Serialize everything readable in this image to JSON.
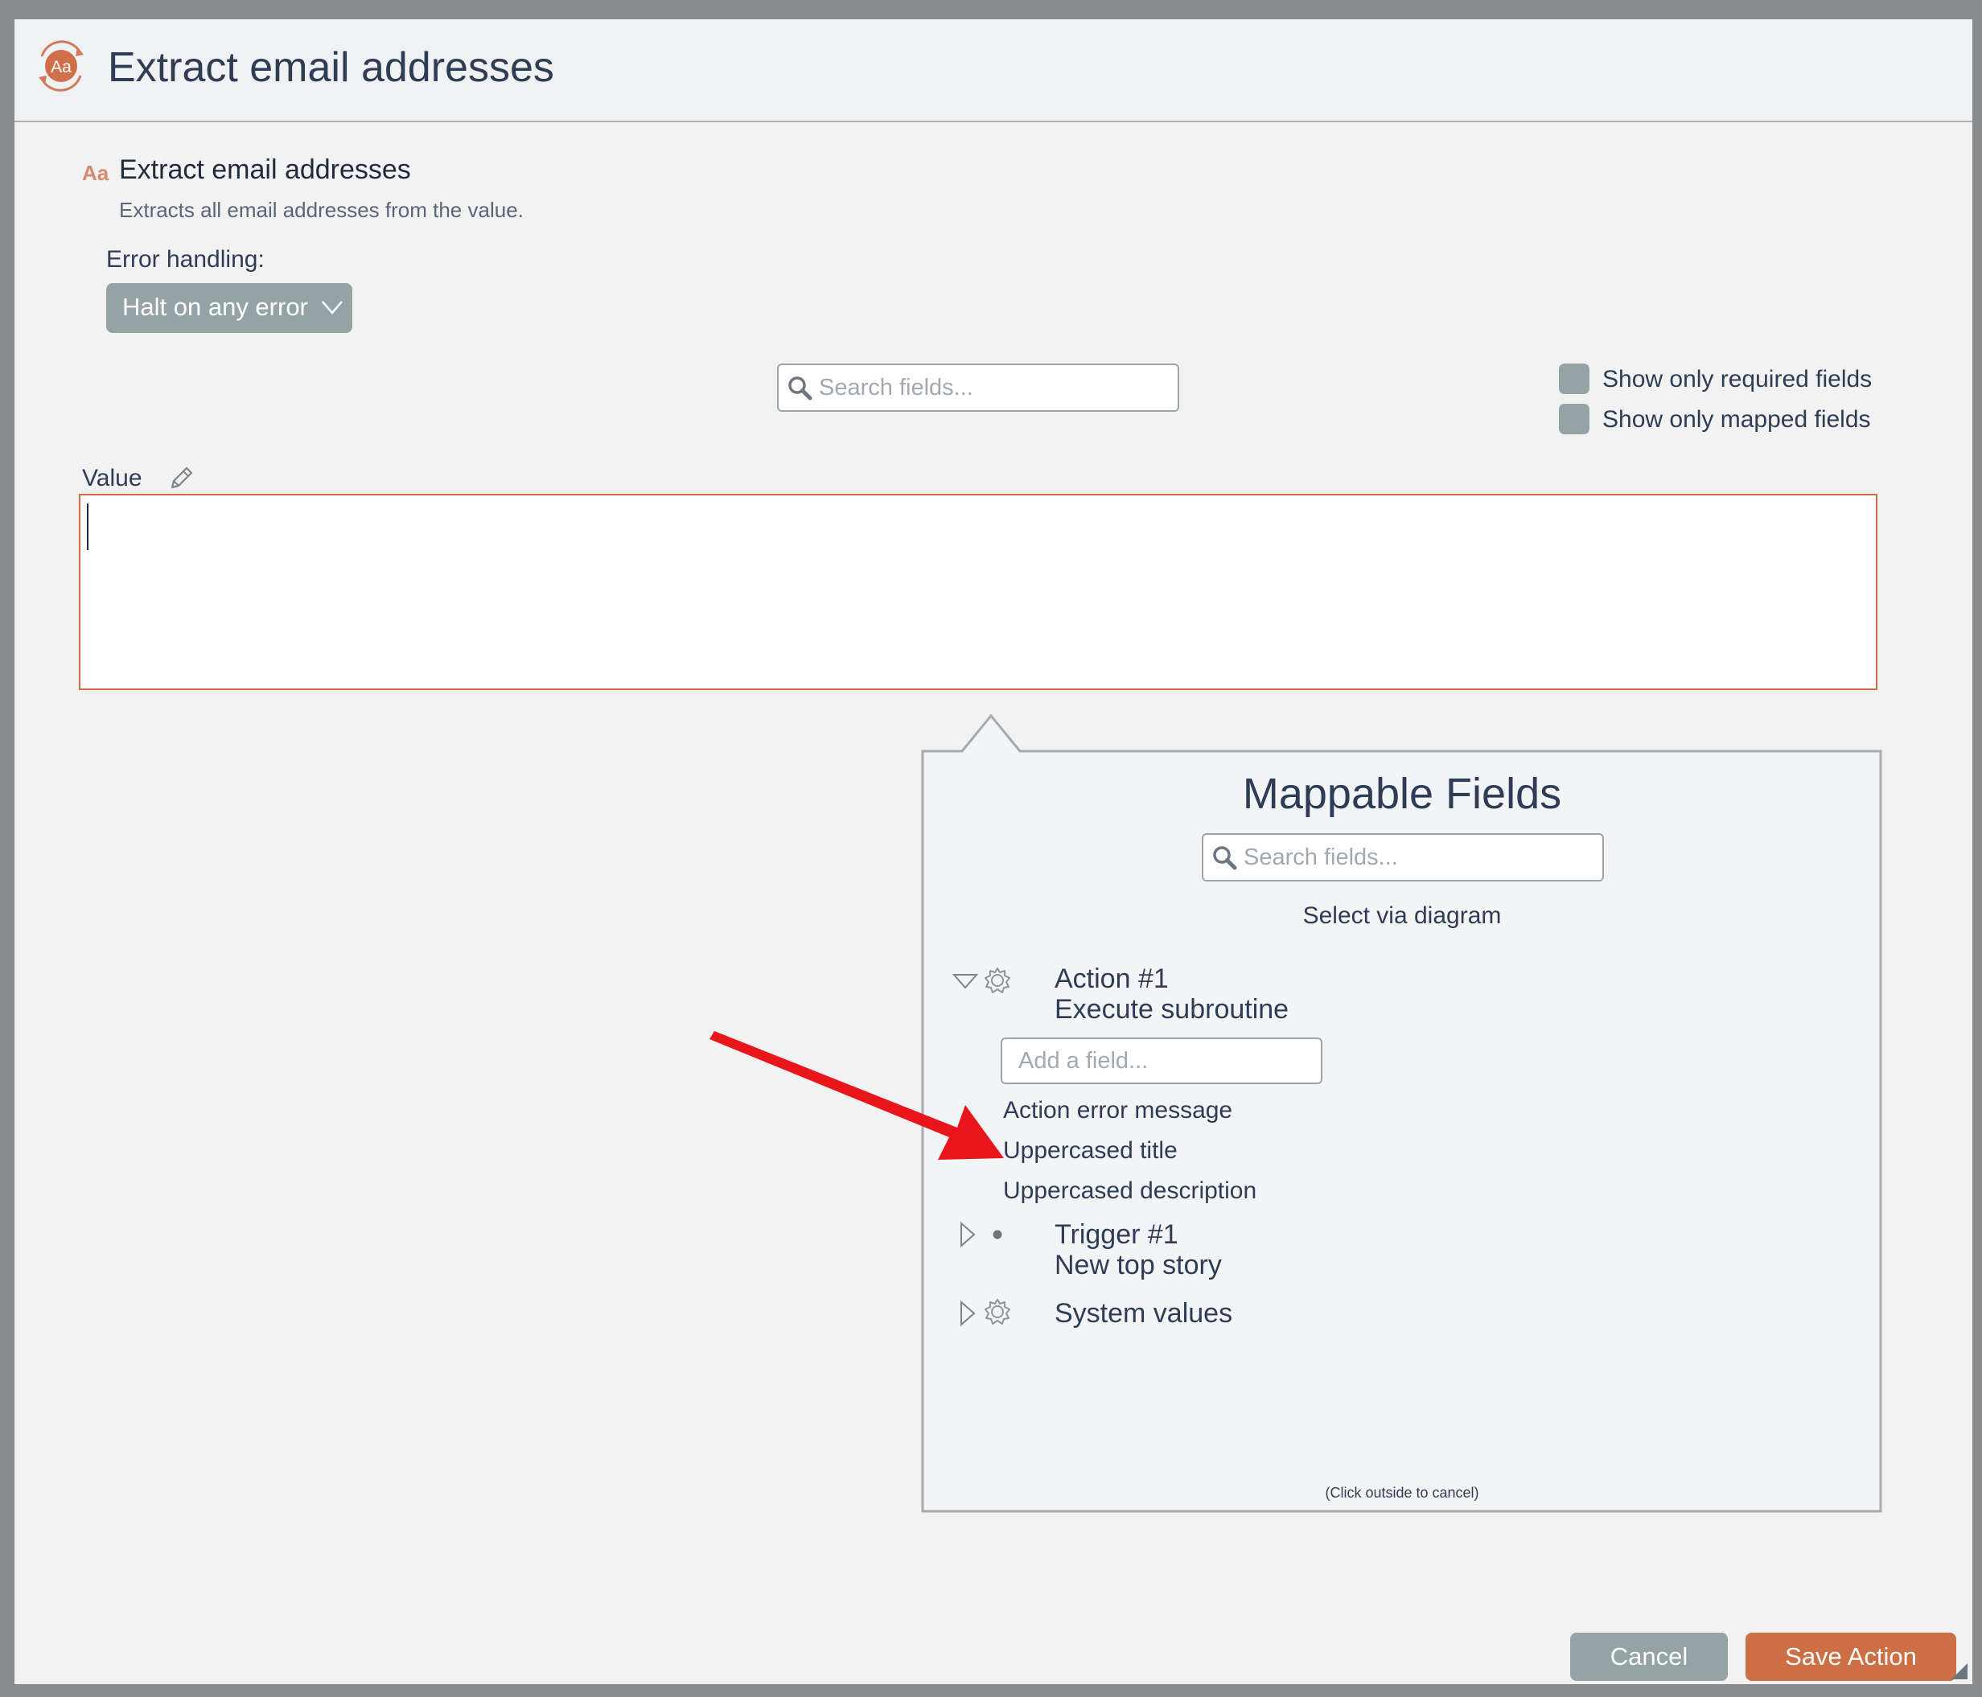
{
  "window": {
    "title": "Extract email addresses",
    "app_icon_text": "Aa"
  },
  "action": {
    "icon_text": "Aa",
    "title": "Extract email addresses",
    "description": "Extracts all email addresses from the value."
  },
  "error_handling": {
    "label": "Error handling:",
    "selected": "Halt on any error"
  },
  "search": {
    "placeholder": "Search fields..."
  },
  "filters": {
    "required_label": "Show only required fields",
    "mapped_label": "Show only mapped fields"
  },
  "value_field": {
    "label": "Value",
    "content": ""
  },
  "mappable": {
    "title": "Mappable Fields",
    "search_placeholder": "Search fields...",
    "select_via_diagram": "Select via diagram",
    "groups": [
      {
        "title": "Action #1",
        "subtitle": "Execute subroutine",
        "expanded": true,
        "icon": "gear-icon"
      },
      {
        "title": "Trigger #1",
        "subtitle": "New top story",
        "expanded": false,
        "icon": "dot-icon"
      },
      {
        "title": "System values",
        "subtitle": "",
        "expanded": false,
        "icon": "gear-icon"
      }
    ],
    "add_field_placeholder": "Add a field...",
    "fields": [
      "Action error message",
      "Uppercased title",
      "Uppercased description"
    ],
    "cancel_hint": "(Click outside to cancel)"
  },
  "buttons": {
    "cancel": "Cancel",
    "save": "Save Action"
  },
  "colors": {
    "accent": "#cd6f44",
    "muted_button": "#95a3a5",
    "text": "#2e3d55",
    "arrow": "#e8161b"
  }
}
